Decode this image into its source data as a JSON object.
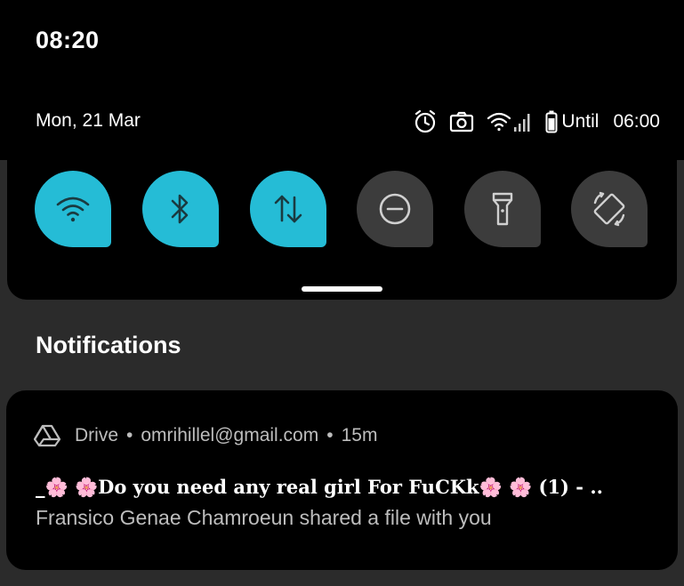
{
  "status_bar": {
    "time": "08:20",
    "date": "Mon, 21 Mar",
    "icons": [
      "alarm-icon",
      "screenshot-icon",
      "wifi-signal-icon",
      "cell-signal-icon",
      "battery-icon"
    ],
    "battery_label": "Until",
    "until_time": "06:00"
  },
  "quick_settings": {
    "tiles": [
      {
        "name": "wifi",
        "icon": "wifi-icon",
        "active": true
      },
      {
        "name": "bluetooth",
        "icon": "bluetooth-icon",
        "active": true
      },
      {
        "name": "mobile-data",
        "icon": "mobile-data-icon",
        "active": true
      },
      {
        "name": "do-not-disturb",
        "icon": "do-not-disturb-icon",
        "active": false
      },
      {
        "name": "flashlight",
        "icon": "flashlight-icon",
        "active": false
      },
      {
        "name": "auto-rotate",
        "icon": "auto-rotate-icon",
        "active": false
      }
    ],
    "active_color": "#25bcd6",
    "inactive_color": "#3c3c3c"
  },
  "notifications": {
    "section_title": "Notifications",
    "items": [
      {
        "app_icon": "drive-icon",
        "app_name": "Drive",
        "account": "omrihillel@gmail.com",
        "age": "15m",
        "title": "_🌸 🌸Do you need any real girl For FuCKk🌸 🌸 (1) - ..",
        "body": "Fransico Genae Chamroeun shared a file with you"
      }
    ]
  }
}
